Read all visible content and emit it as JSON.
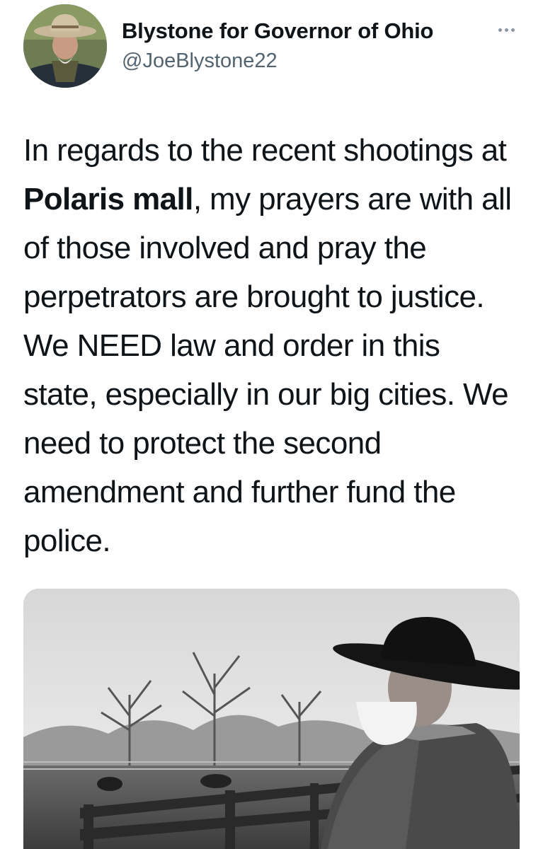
{
  "tweet": {
    "author": {
      "display_name": "Blystone for Governor of Ohio",
      "handle": "@JoeBlystone22",
      "avatar_icon": "profile-photo-cowboy"
    },
    "more_icon": "more-options-icon",
    "text": {
      "part1": "In regards to the recent shootings at ",
      "bold": "Polaris mall",
      "part2": ", my prayers are with all of those involved and pray the perpetrators are brought to justice. We NEED law and order in this state, especially in our big cities. We need to protect the second amendment and further fund the police."
    },
    "media": {
      "icon": "photo-man-in-cowboy-hat-at-ranch-fence"
    },
    "colors": {
      "text": "#0f1419",
      "secondary": "#536471"
    }
  }
}
